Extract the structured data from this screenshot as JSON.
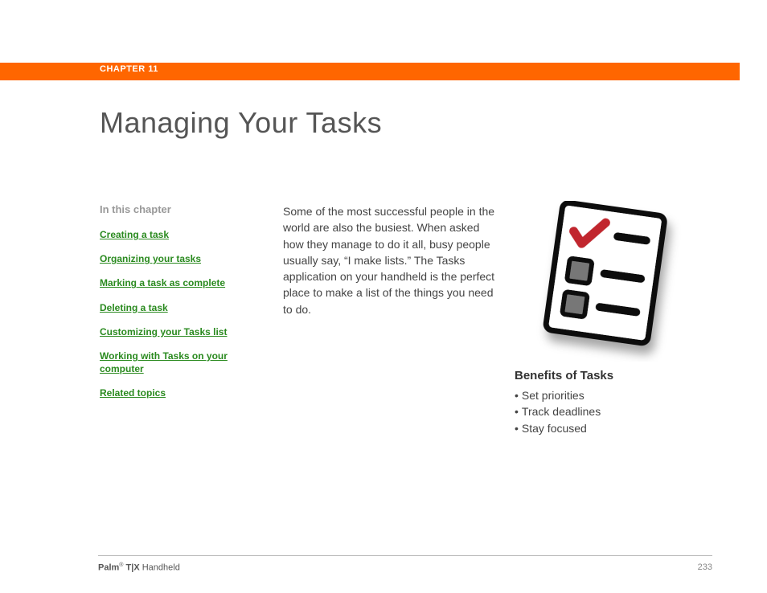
{
  "chapter": {
    "label": "CHAPTER 11"
  },
  "title": "Managing Your Tasks",
  "toc": {
    "heading": "In this chapter",
    "links": [
      "Creating a task",
      "Organizing your tasks",
      "Marking a task as complete",
      "Deleting a task",
      "Customizing your Tasks list",
      "Working with Tasks on your computer",
      "Related topics"
    ]
  },
  "intro": "Some of the most successful people in the world are also the busiest. When asked how they manage to do it all, busy people usually say, “I make lists.” The Tasks application on your handheld is the perfect place to make a list of the things you need to do.",
  "benefits": {
    "heading": "Benefits of Tasks",
    "items": [
      "Set priorities",
      "Track deadlines",
      "Stay focused"
    ]
  },
  "footer": {
    "brand": "Palm",
    "reg": "®",
    "model": " T|X",
    "suffix": " Handheld",
    "page": "233"
  }
}
